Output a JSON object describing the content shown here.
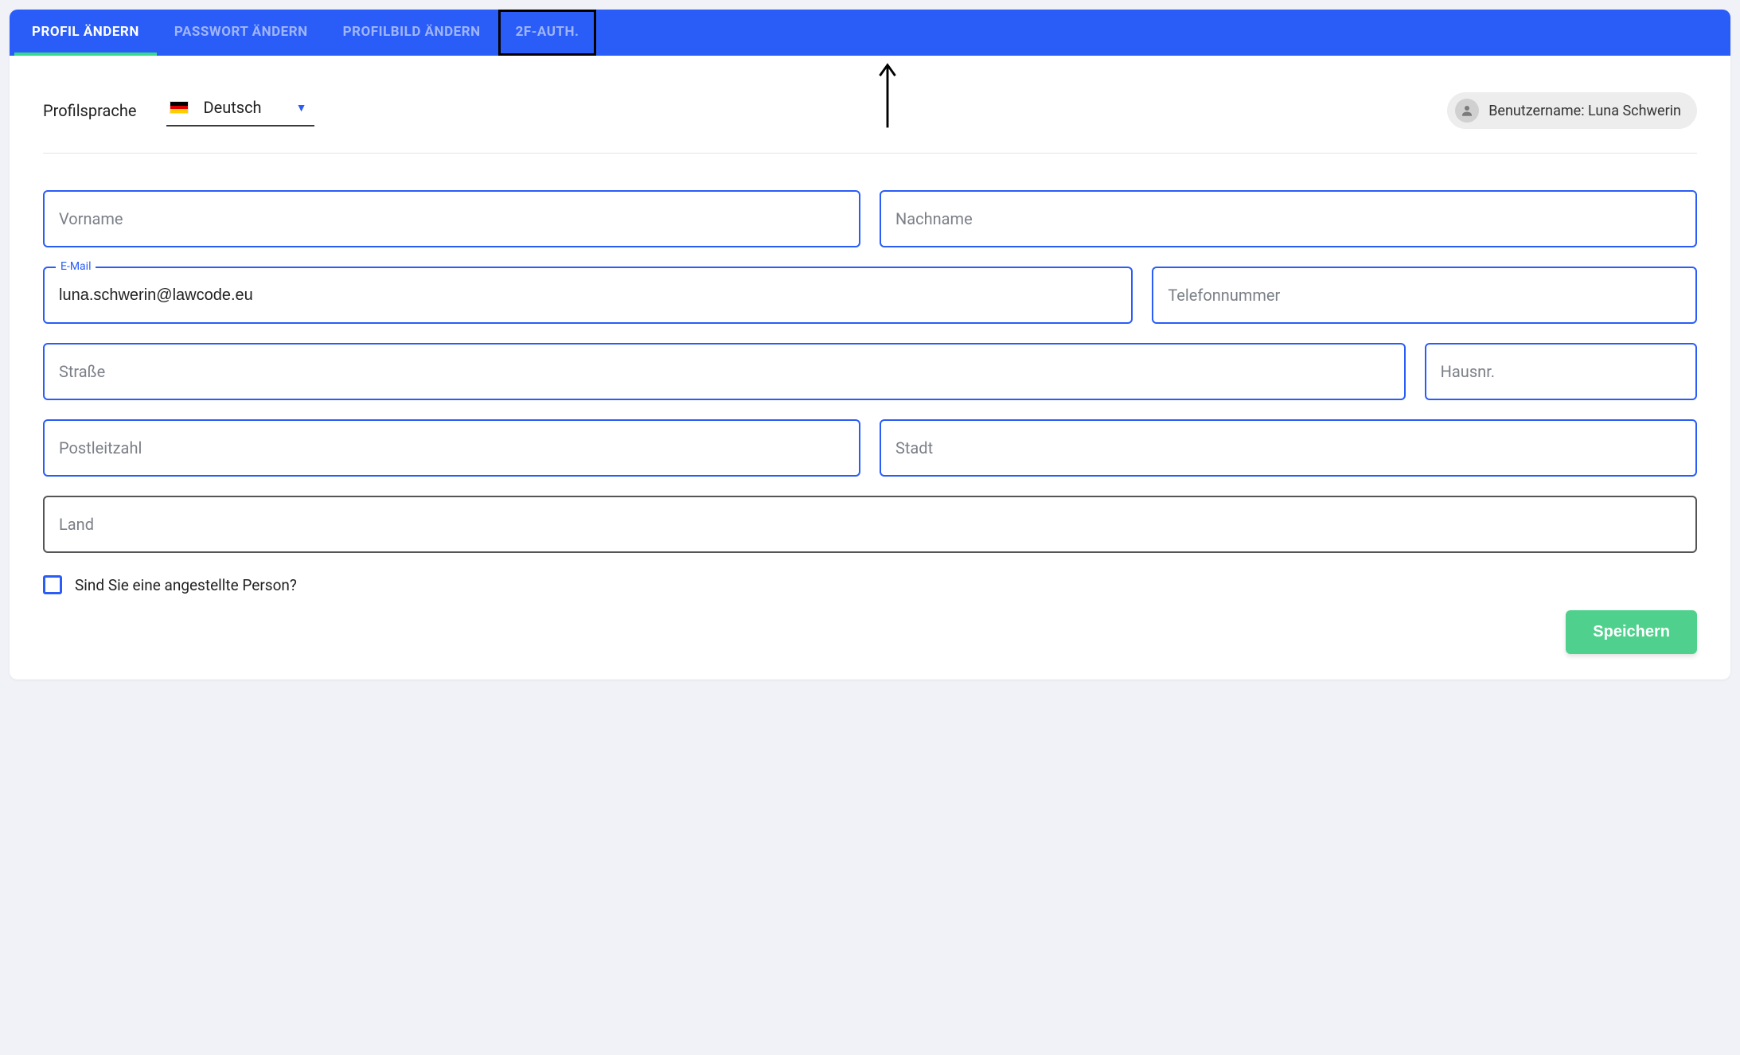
{
  "tabs": {
    "profile": "PROFIL ÄNDERN",
    "password": "PASSWORT ÄNDERN",
    "avatar": "PROFILBILD ÄNDERN",
    "twofa": "2F-AUTH."
  },
  "language": {
    "label": "Profilsprache",
    "value": "Deutsch"
  },
  "userchip": {
    "text": "Benutzername: Luna Schwerin"
  },
  "fields": {
    "first_name": {
      "label": "Vorname",
      "value": ""
    },
    "last_name": {
      "label": "Nachname",
      "value": ""
    },
    "email": {
      "label": "E-Mail",
      "value": "luna.schwerin@lawcode.eu"
    },
    "phone": {
      "label": "Telefonnummer",
      "value": ""
    },
    "street": {
      "label": "Straße",
      "value": ""
    },
    "houseno": {
      "label": "Hausnr.",
      "value": ""
    },
    "zip": {
      "label": "Postleitzahl",
      "value": ""
    },
    "city": {
      "label": "Stadt",
      "value": ""
    },
    "country": {
      "label": "Land",
      "value": ""
    }
  },
  "checkbox": {
    "label": "Sind Sie eine angestellte Person?",
    "checked": false
  },
  "buttons": {
    "save": "Speichern"
  }
}
